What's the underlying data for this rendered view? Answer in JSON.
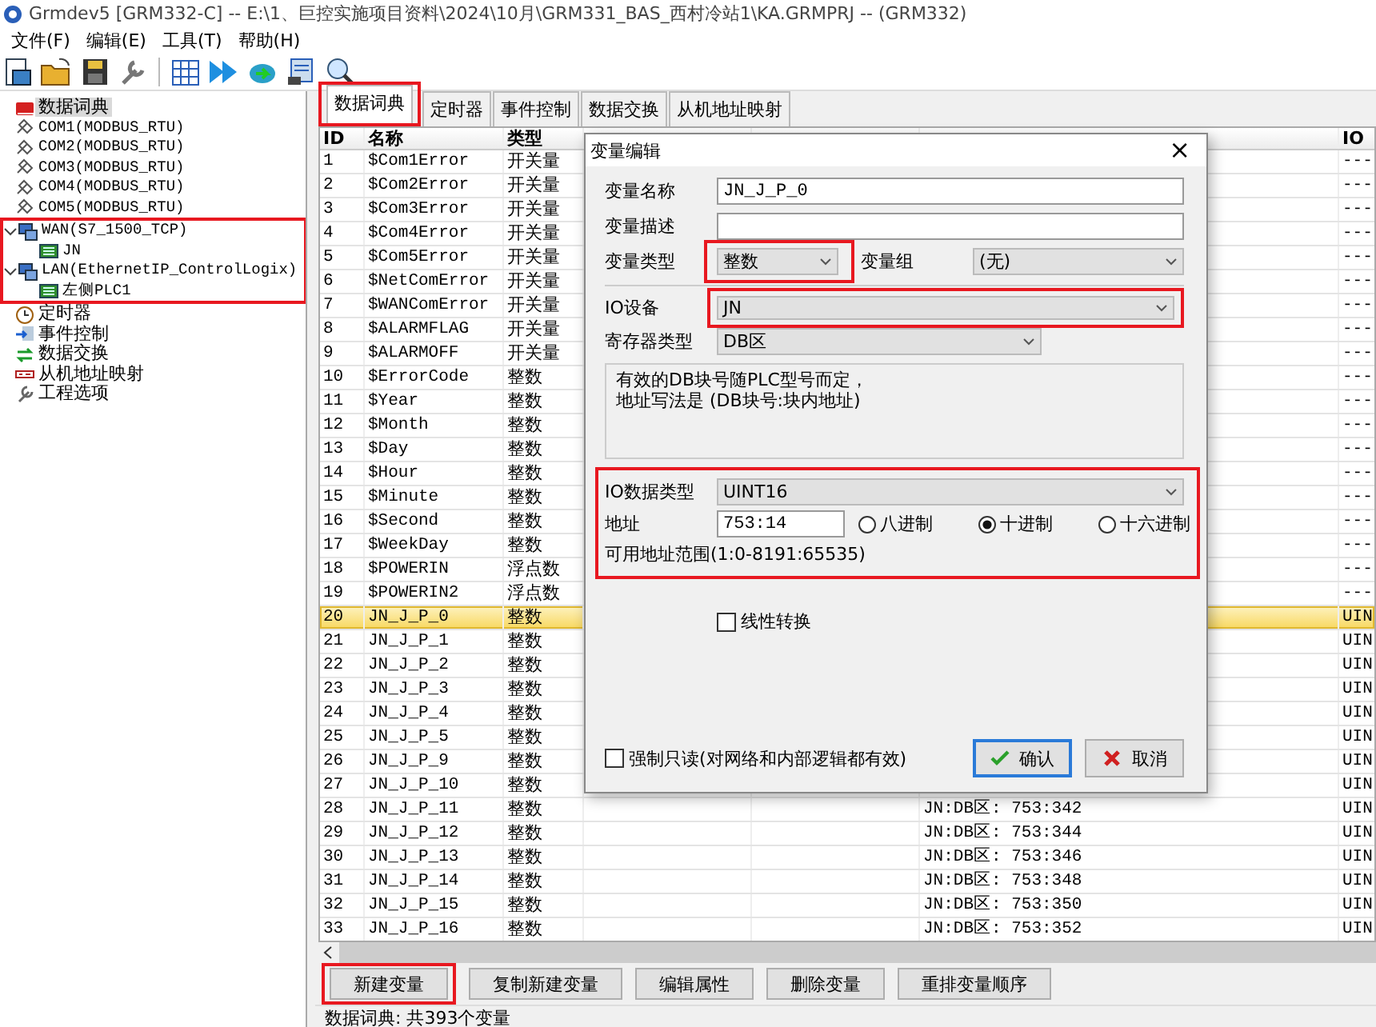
{
  "window": {
    "title": "Grmdev5 [GRM332-C]  -- E:\\1、巨控实施项目资料\\2024\\10月\\GRM331_BAS_西村冷站1\\KA.GRMPRJ -- (GRM332)"
  },
  "menu": [
    "文件(F)",
    "编辑(E)",
    "工具(T)",
    "帮助(H)"
  ],
  "tree": [
    {
      "label": "数据词典",
      "kind": "dictionary",
      "selected": true
    },
    {
      "label": "COM1(MODBUS_RTU)",
      "kind": "port",
      "selected": false
    },
    {
      "label": "COM2(MODBUS_RTU)",
      "kind": "port",
      "selected": false
    },
    {
      "label": "COM3(MODBUS_RTU)",
      "kind": "port",
      "selected": false
    },
    {
      "label": "COM4(MODBUS_RTU)",
      "kind": "port",
      "selected": false
    },
    {
      "label": "COM5(MODBUS_RTU)",
      "kind": "port",
      "selected": false
    },
    {
      "label": "WAN(S7_1500_TCP)",
      "kind": "network",
      "selected": false,
      "expanded": true,
      "highlighted": true,
      "children": [
        {
          "label": "JN",
          "kind": "device",
          "selected": false
        }
      ]
    },
    {
      "label": "LAN(EthernetIP_ControlLogix)",
      "kind": "network",
      "selected": false,
      "expanded": true,
      "highlighted": true,
      "children": [
        {
          "label": "左侧PLC1",
          "kind": "device",
          "selected": false
        }
      ]
    },
    {
      "label": "定时器",
      "kind": "timer",
      "selected": false
    },
    {
      "label": "事件控制",
      "kind": "event",
      "selected": false
    },
    {
      "label": "数据交换",
      "kind": "exchange",
      "selected": false
    },
    {
      "label": "从机地址映射",
      "kind": "mapping",
      "selected": false
    },
    {
      "label": "工程选项",
      "kind": "options",
      "selected": false
    }
  ],
  "tabs": [
    {
      "label": "数据词典",
      "selected": true,
      "highlighted": true
    },
    {
      "label": "定时器",
      "selected": false
    },
    {
      "label": "事件控制",
      "selected": false
    },
    {
      "label": "数据交换",
      "selected": false
    },
    {
      "label": "从机地址映射",
      "selected": false
    }
  ],
  "table": {
    "columns": [
      "ID",
      "名称",
      "类型",
      "IO"
    ],
    "rows": [
      {
        "id": "1",
        "name": "$Com1Error",
        "type": "开关量",
        "io_type": "---",
        "selected": false
      },
      {
        "id": "2",
        "name": "$Com2Error",
        "type": "开关量",
        "io_type": "---",
        "selected": false
      },
      {
        "id": "3",
        "name": "$Com3Error",
        "type": "开关量",
        "io_type": "---",
        "selected": false
      },
      {
        "id": "4",
        "name": "$Com4Error",
        "type": "开关量",
        "io_type": "---",
        "selected": false
      },
      {
        "id": "5",
        "name": "$Com5Error",
        "type": "开关量",
        "io_type": "---",
        "selected": false
      },
      {
        "id": "6",
        "name": "$NetComError",
        "type": "开关量",
        "io_type": "---",
        "selected": false
      },
      {
        "id": "7",
        "name": "$WANComError",
        "type": "开关量",
        "io_type": "---",
        "selected": false
      },
      {
        "id": "8",
        "name": "$ALARMFLAG",
        "type": "开关量",
        "io_type": "---",
        "selected": false
      },
      {
        "id": "9",
        "name": "$ALARMOFF",
        "type": "开关量",
        "io_type": "---",
        "selected": false
      },
      {
        "id": "10",
        "name": "$ErrorCode",
        "type": "整数",
        "io_type": "---",
        "selected": false
      },
      {
        "id": "11",
        "name": "$Year",
        "type": "整数",
        "io_type": "---",
        "selected": false
      },
      {
        "id": "12",
        "name": "$Month",
        "type": "整数",
        "io_type": "---",
        "selected": false
      },
      {
        "id": "13",
        "name": "$Day",
        "type": "整数",
        "io_type": "---",
        "selected": false
      },
      {
        "id": "14",
        "name": "$Hour",
        "type": "整数",
        "io_type": "---",
        "selected": false
      },
      {
        "id": "15",
        "name": "$Minute",
        "type": "整数",
        "io_type": "---",
        "selected": false
      },
      {
        "id": "16",
        "name": "$Second",
        "type": "整数",
        "io_type": "---",
        "selected": false
      },
      {
        "id": "17",
        "name": "$WeekDay",
        "type": "整数",
        "io_type": "---",
        "selected": false
      },
      {
        "id": "18",
        "name": "$POWERIN",
        "type": "浮点数",
        "io_type": "---",
        "selected": false
      },
      {
        "id": "19",
        "name": "$POWERIN2",
        "type": "浮点数",
        "io_type": "---",
        "selected": false
      },
      {
        "id": "20",
        "name": "JN_J_P_0",
        "type": "整数",
        "io_type": "UIN",
        "selected": true
      },
      {
        "id": "21",
        "name": "JN_J_P_1",
        "type": "整数",
        "io_type": "UIN",
        "selected": false
      },
      {
        "id": "22",
        "name": "JN_J_P_2",
        "type": "整数",
        "io_type": "UIN",
        "selected": false
      },
      {
        "id": "23",
        "name": "JN_J_P_3",
        "type": "整数",
        "io_type": "UIN",
        "selected": false
      },
      {
        "id": "24",
        "name": "JN_J_P_4",
        "type": "整数",
        "io_type": "UIN",
        "selected": false
      },
      {
        "id": "25",
        "name": "JN_J_P_5",
        "type": "整数",
        "io_type": "UIN",
        "selected": false
      },
      {
        "id": "26",
        "name": "JN_J_P_9",
        "type": "整数",
        "io_type": "UIN",
        "selected": false
      },
      {
        "id": "27",
        "name": "JN_J_P_10",
        "type": "整数",
        "io_type": "UIN",
        "selected": false
      },
      {
        "id": "28",
        "name": "JN_J_P_11",
        "type": "整数",
        "address": "JN:DB区: 753:342",
        "io_type": "UIN",
        "selected": false
      },
      {
        "id": "29",
        "name": "JN_J_P_12",
        "type": "整数",
        "address": "JN:DB区: 753:344",
        "io_type": "UIN",
        "selected": false
      },
      {
        "id": "30",
        "name": "JN_J_P_13",
        "type": "整数",
        "address": "JN:DB区: 753:346",
        "io_type": "UIN",
        "selected": false
      },
      {
        "id": "31",
        "name": "JN_J_P_14",
        "type": "整数",
        "address": "JN:DB区: 753:348",
        "io_type": "UIN",
        "selected": false
      },
      {
        "id": "32",
        "name": "JN_J_P_15",
        "type": "整数",
        "address": "JN:DB区: 753:350",
        "io_type": "UIN",
        "selected": false
      },
      {
        "id": "33",
        "name": "JN_J_P_16",
        "type": "整数",
        "address": "JN:DB区: 753:352",
        "io_type": "UIN",
        "selected": false
      }
    ]
  },
  "actions": [
    {
      "label": "新建变量",
      "highlighted": true
    },
    {
      "label": "复制新建变量"
    },
    {
      "label": "编辑属性"
    },
    {
      "label": "删除变量"
    },
    {
      "label": "重排变量顺序"
    }
  ],
  "status_bar": "数据词典: 共393个变量",
  "dialog": {
    "title": "变量编辑",
    "close": "×",
    "name": {
      "label": "变量名称",
      "value": "JN_J_P_0"
    },
    "description": {
      "label": "变量描述"
    },
    "var_type": {
      "label": "变量类型",
      "value": "整数",
      "highlighted": true
    },
    "var_group": {
      "label": "变量组",
      "value": "(无)"
    },
    "io_device": {
      "label": "IO设备",
      "value": "JN",
      "highlighted": true
    },
    "register_type": {
      "label": "寄存器类型",
      "value": "DB区"
    },
    "hint": [
      "有效的DB块号随PLC型号而定，",
      "地址写法是 (DB块号:块内地址)"
    ],
    "io_section": {
      "highlighted": true,
      "data_type": {
        "label": "IO数据类型",
        "value": "UINT16"
      },
      "address": {
        "label": "地址",
        "value": "753:14"
      },
      "radix": [
        {
          "label": "八进制",
          "selected": false
        },
        {
          "label": "十进制",
          "selected": true
        },
        {
          "label": "十六进制",
          "selected": false
        }
      ],
      "range": "可用地址范围(1:0-8191:65535)"
    },
    "linear": {
      "label": "线性转换",
      "checked": false
    },
    "readonly": {
      "label": "强制只读(对网络和内部逻辑都有效)",
      "checked": false
    },
    "buttons": [
      {
        "label": "确认",
        "kind": "ok",
        "focused": true
      },
      {
        "label": "取消",
        "kind": "cancel",
        "focused": false
      }
    ]
  }
}
